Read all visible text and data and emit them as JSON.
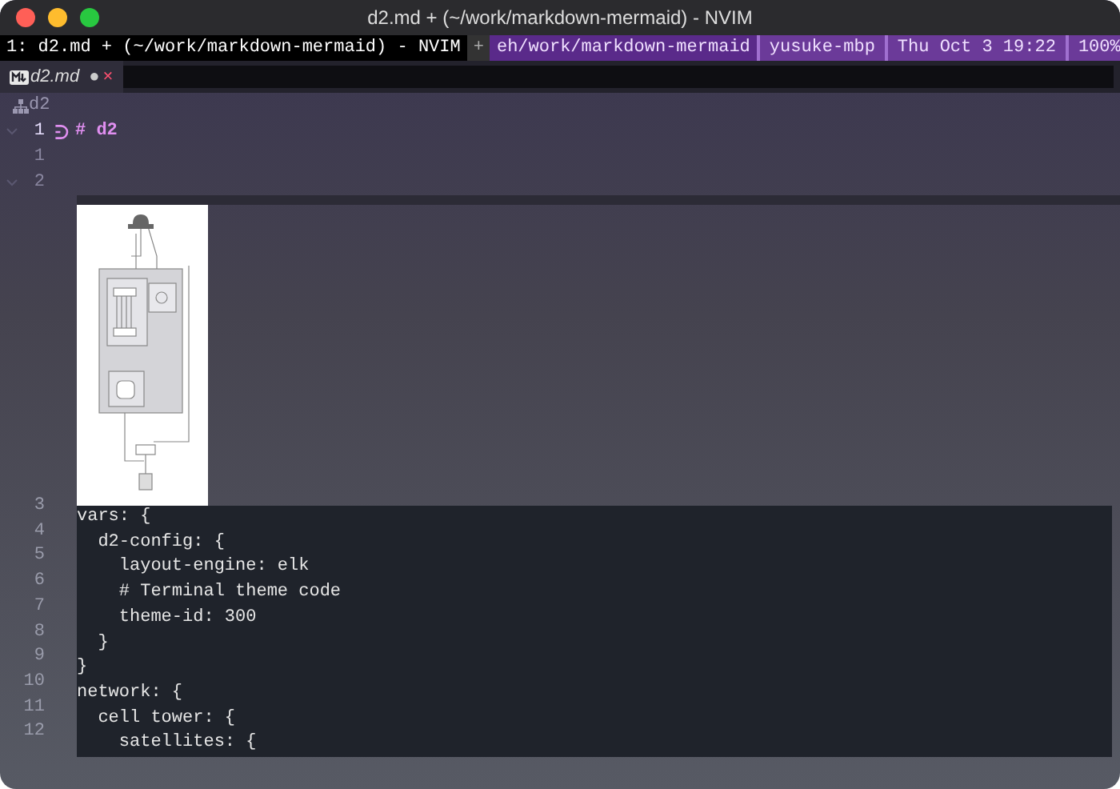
{
  "window": {
    "title": "d2.md + (~/work/markdown-mermaid) - NVIM"
  },
  "tmux": {
    "window_label": "1: d2.md + (~/work/markdown-mermaid) - NVIM",
    "segments": [
      {
        "text": "+",
        "kind": "plain"
      },
      {
        "text": "eh/work/markdown-mermaid",
        "kind": "path"
      },
      {
        "text": "yusuke-mbp",
        "kind": "host"
      },
      {
        "text": "Thu Oct 3 19:22",
        "kind": "host"
      },
      {
        "text": "100%",
        "kind": "host"
      }
    ]
  },
  "buffer_tabs": [
    {
      "label": "d2.md",
      "selected": true,
      "modified": true,
      "modified_mark": "●",
      "close": "×"
    }
  ],
  "breadcrumb": "d2",
  "lines": [
    {
      "number": "1",
      "current": true,
      "fold": true,
      "text": "# d2"
    },
    {
      "number": "1",
      "current": false,
      "fold": false
    },
    {
      "number": "2",
      "current": false,
      "fold": true
    }
  ],
  "code_lines": [
    {
      "number": "3",
      "text": "vars: {"
    },
    {
      "number": "4",
      "text": "  d2-config: {"
    },
    {
      "number": "5",
      "text": "    layout-engine: elk"
    },
    {
      "number": "6",
      "text": "    # Terminal theme code"
    },
    {
      "number": "7",
      "text": "    theme-id: 300"
    },
    {
      "number": "8",
      "text": "  }"
    },
    {
      "number": "9",
      "text": "}"
    },
    {
      "number": "10",
      "text": "network: {"
    },
    {
      "number": "11",
      "text": "  cell tower: {"
    },
    {
      "number": "12",
      "text": "    satellites: {"
    }
  ]
}
